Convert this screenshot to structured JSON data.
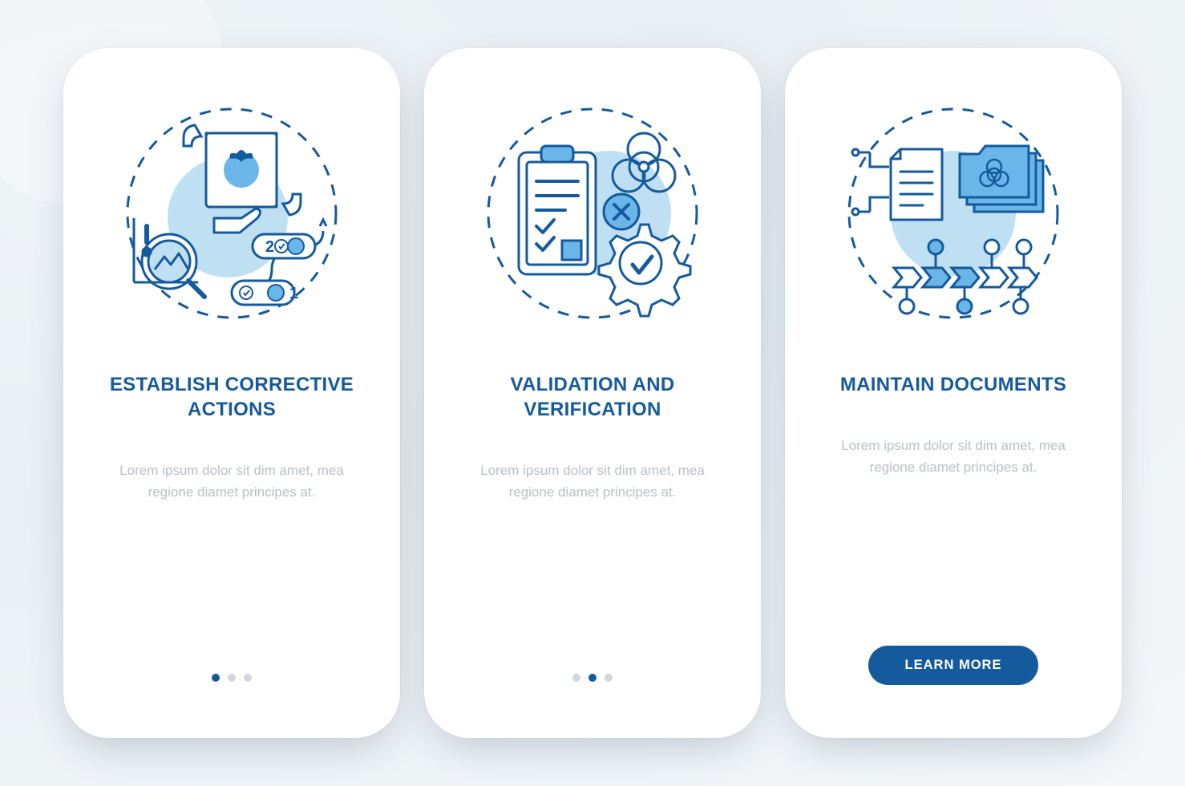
{
  "colors": {
    "primary": "#155a9d",
    "accent": "#6bb6e8",
    "light": "#bfe0f3",
    "muted": "#b9c0c6"
  },
  "screens": [
    {
      "icon_name": "corrective-actions-icon",
      "title": "ESTABLISH CORRECTIVE ACTIONS",
      "description": "Lorem ipsum dolor sit dim amet, mea regione diamet principes at.",
      "indicator": {
        "count": 3,
        "active": 0
      },
      "cta": null
    },
    {
      "icon_name": "validation-verification-icon",
      "title": "VALIDATION AND VERIFICATION",
      "description": "Lorem ipsum dolor sit dim amet, mea regione diamet principes at.",
      "indicator": {
        "count": 3,
        "active": 1
      },
      "cta": null
    },
    {
      "icon_name": "maintain-documents-icon",
      "title": "MAINTAIN DOCUMENTS",
      "description": "Lorem ipsum dolor sit dim amet, mea regione diamet principes at.",
      "indicator": null,
      "cta": "LEARN MORE"
    }
  ]
}
